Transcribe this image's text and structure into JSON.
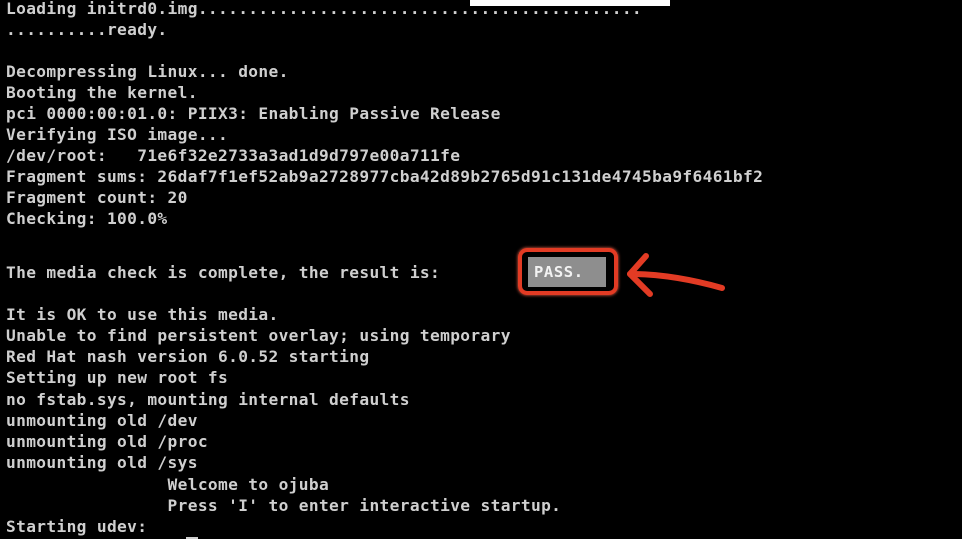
{
  "console": {
    "lines": [
      "Loading initrd0.img............................................",
      "..........ready.",
      "",
      "Decompressing Linux... done.",
      "Booting the kernel.",
      "pci 0000:00:01.0: PIIX3: Enabling Passive Release",
      "Verifying ISO image...",
      "/dev/root:   71e6f32e2733a3ad1d9d797e00a711fe",
      "Fragment sums: 26daf7f1ef52ab9a2728977cba42d89b2765d91c131de4745ba9f6461bf2",
      "Fragment count: 20",
      "Checking: 100.0%",
      "",
      "The media check is complete, the result is:",
      "",
      "It is OK to use this media.",
      "Unable to find persistent overlay; using temporary",
      "Red Hat nash version 6.0.52 starting",
      "Setting up new root fs",
      "no fstab.sys, mounting internal defaults",
      "unmounting old /dev",
      "unmounting old /proc",
      "unmounting old /sys",
      "                Welcome to ojuba",
      "                Press 'I' to enter interactive startup.",
      "Starting udev:"
    ],
    "result_badge": "PASS.",
    "colors": {
      "background": "#000000",
      "text": "#cfcfcf",
      "badge_background": "#8e8e8e",
      "annotation": "#e23b24"
    }
  }
}
